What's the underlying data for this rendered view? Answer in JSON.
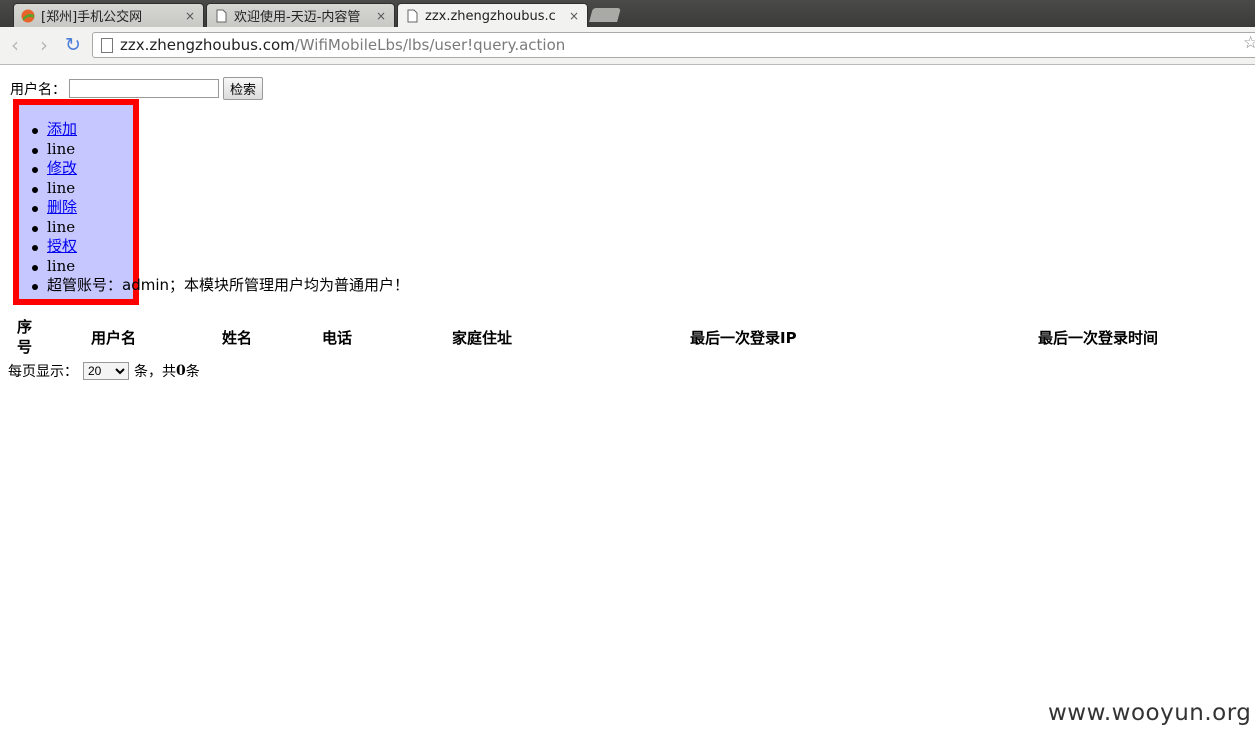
{
  "browser": {
    "tabs": [
      {
        "title": "[郑州]手机公交网",
        "icon": "site-favicon-orange-green",
        "active": false
      },
      {
        "title": "欢迎使用-天迈-内容管",
        "icon": "page-icon",
        "active": false
      },
      {
        "title": "zzx.zhengzhoubus.c",
        "icon": "page-icon",
        "active": true
      }
    ],
    "close_glyph": "×",
    "back_glyph": "‹",
    "forward_glyph": "›",
    "reload_glyph": "↻",
    "star_glyph": "☆",
    "url_host": "zzx.zhengzhoubus.com",
    "url_path": "/WifiMobileLbs/lbs/user!query.action"
  },
  "search": {
    "label": "用户名：",
    "value": "",
    "button_label": "检索"
  },
  "menu": {
    "add": "添加",
    "edit": "修改",
    "delete": "删除",
    "authorize": "授权",
    "separator": "line",
    "notice_prefix": "超管账号：",
    "notice_account": "admin",
    "notice_suffix": "；本模块所管理用户均为普通用户！",
    "box_color": "#c7c7ff",
    "border_color": "#ff0000"
  },
  "table": {
    "headers": [
      "序号",
      "用户名",
      "姓名",
      "电话",
      "家庭住址",
      "最后一次登录IP",
      "最后一次登录时间"
    ],
    "rows": []
  },
  "pager": {
    "prefix": "每页显示：",
    "page_size": "20",
    "middle": "条，共",
    "total": "0",
    "suffix": "条"
  },
  "watermark": "www.wooyun.org"
}
